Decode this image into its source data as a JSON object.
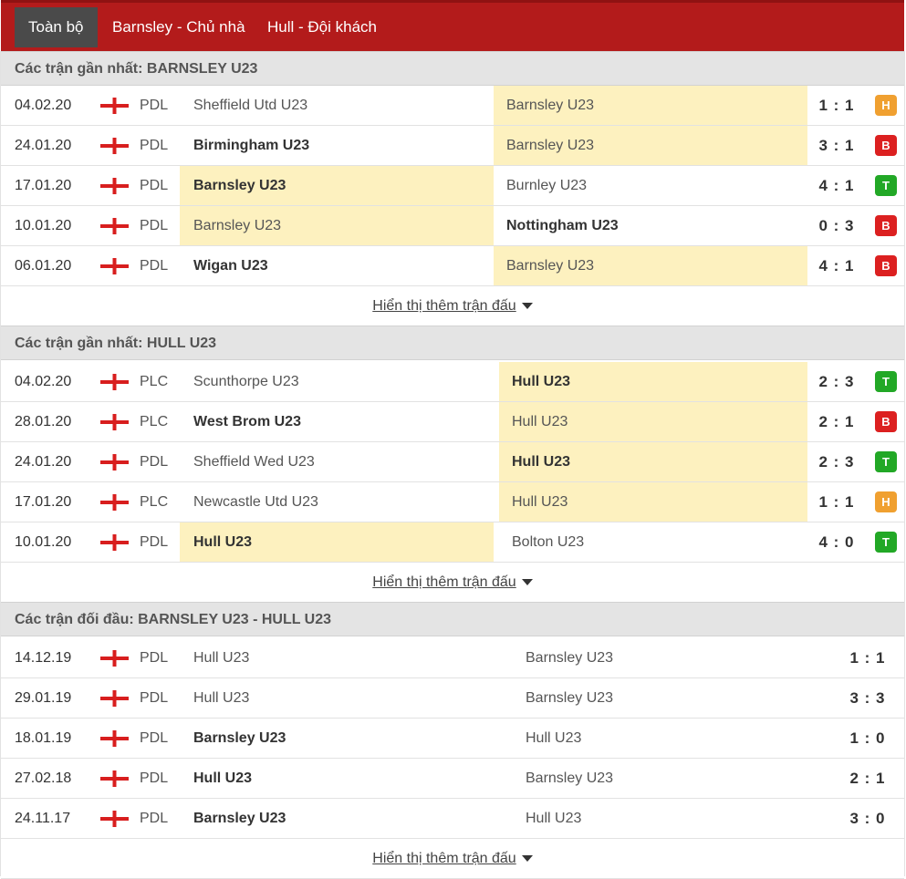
{
  "tabs": [
    {
      "label": "Toàn bộ",
      "active": true
    },
    {
      "label": "Barnsley - Chủ nhà",
      "active": false
    },
    {
      "label": "Hull - Đội khách",
      "active": false
    }
  ],
  "colors": {
    "topbar": "#b31b1b",
    "active_tab": "#4a4a4a",
    "highlight": "#fdf1bf",
    "draw": "#f0a030",
    "loss": "#dc2020",
    "win": "#22a826"
  },
  "flag_icon": "england-flag-icon",
  "show_more_label": "Hiển thị thêm trận đấu",
  "sections": [
    {
      "title": "Các trận gần nhất: BARNSLEY U23",
      "rows": [
        {
          "date": "04.02.20",
          "league": "PDL",
          "home": "Sheffield Utd U23",
          "away": "Barnsley U23",
          "score": "1 : 1",
          "result": "H",
          "winner": "",
          "hl": "away"
        },
        {
          "date": "24.01.20",
          "league": "PDL",
          "home": "Birmingham U23",
          "away": "Barnsley U23",
          "score": "3 : 1",
          "result": "B",
          "winner": "home",
          "hl": "away"
        },
        {
          "date": "17.01.20",
          "league": "PDL",
          "home": "Barnsley U23",
          "away": "Burnley U23",
          "score": "4 : 1",
          "result": "T",
          "winner": "home",
          "hl": "home"
        },
        {
          "date": "10.01.20",
          "league": "PDL",
          "home": "Barnsley U23",
          "away": "Nottingham U23",
          "score": "0 : 3",
          "result": "B",
          "winner": "away",
          "hl": "home"
        },
        {
          "date": "06.01.20",
          "league": "PDL",
          "home": "Wigan U23",
          "away": "Barnsley U23",
          "score": "4 : 1",
          "result": "B",
          "winner": "home",
          "hl": "away"
        }
      ]
    },
    {
      "title": "Các trận gần nhất: HULL U23",
      "rows": [
        {
          "date": "04.02.20",
          "league": "PLC",
          "home": "Scunthorpe U23",
          "away": "Hull U23",
          "score": "2 : 3",
          "result": "T",
          "winner": "away",
          "hl": "away"
        },
        {
          "date": "28.01.20",
          "league": "PLC",
          "home": "West Brom U23",
          "away": "Hull U23",
          "score": "2 : 1",
          "result": "B",
          "winner": "home",
          "hl": "away"
        },
        {
          "date": "24.01.20",
          "league": "PDL",
          "home": "Sheffield Wed U23",
          "away": "Hull U23",
          "score": "2 : 3",
          "result": "T",
          "winner": "away",
          "hl": "away"
        },
        {
          "date": "17.01.20",
          "league": "PLC",
          "home": "Newcastle Utd U23",
          "away": "Hull U23",
          "score": "1 : 1",
          "result": "H",
          "winner": "",
          "hl": "away"
        },
        {
          "date": "10.01.20",
          "league": "PDL",
          "home": "Hull U23",
          "away": "Bolton U23",
          "score": "4 : 0",
          "result": "T",
          "winner": "home",
          "hl": "home"
        }
      ]
    },
    {
      "title": "Các trận đối đầu: BARNSLEY U23 - HULL U23",
      "rows": [
        {
          "date": "14.12.19",
          "league": "PDL",
          "home": "Hull U23",
          "away": "Barnsley U23",
          "score": "1 : 1",
          "result": "",
          "winner": "",
          "hl": ""
        },
        {
          "date": "29.01.19",
          "league": "PDL",
          "home": "Hull U23",
          "away": "Barnsley U23",
          "score": "3 : 3",
          "result": "",
          "winner": "",
          "hl": ""
        },
        {
          "date": "18.01.19",
          "league": "PDL",
          "home": "Barnsley U23",
          "away": "Hull U23",
          "score": "1 : 0",
          "result": "",
          "winner": "home",
          "hl": ""
        },
        {
          "date": "27.02.18",
          "league": "PDL",
          "home": "Hull U23",
          "away": "Barnsley U23",
          "score": "2 : 1",
          "result": "",
          "winner": "home",
          "hl": ""
        },
        {
          "date": "24.11.17",
          "league": "PDL",
          "home": "Barnsley U23",
          "away": "Hull U23",
          "score": "3 : 0",
          "result": "",
          "winner": "home",
          "hl": ""
        }
      ]
    }
  ]
}
